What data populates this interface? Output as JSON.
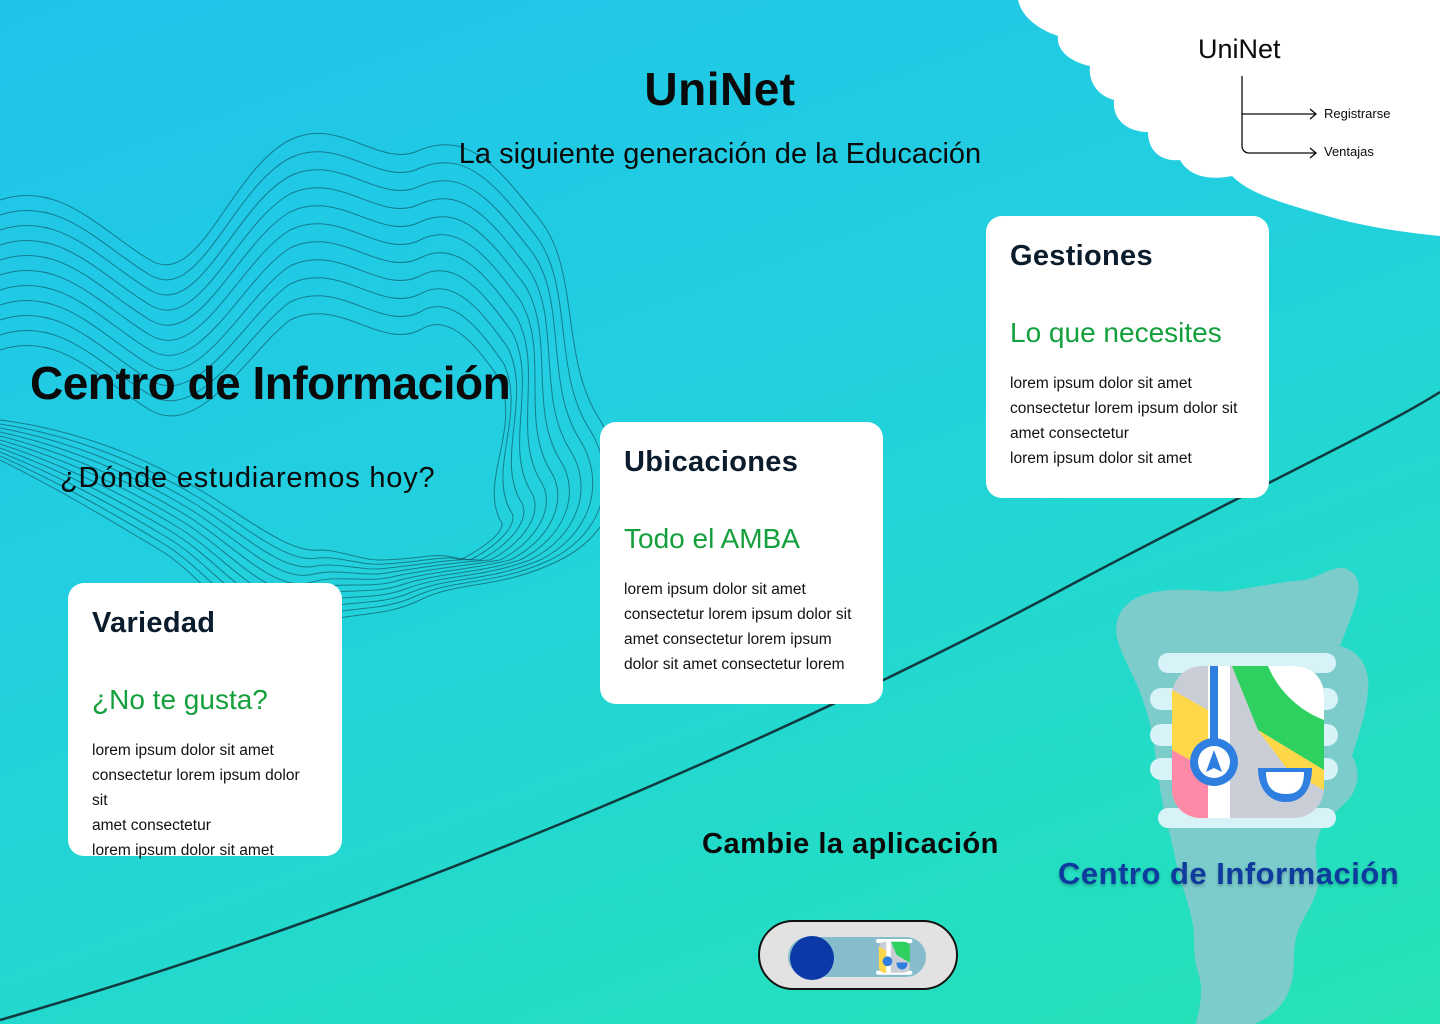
{
  "brand": {
    "title": "UniNet",
    "subtitle": "La siguiente generación de la Educación"
  },
  "hero": {
    "title": "Centro de Información",
    "question": "¿Dónde estudiaremos hoy?"
  },
  "nav": {
    "title": "UniNet",
    "items": [
      {
        "label": "Registrarse"
      },
      {
        "label": "Ventajas"
      }
    ]
  },
  "cards": [
    {
      "title": "Variedad",
      "subtitle": "¿No te gusta?",
      "body": "lorem ipsum dolor sit amet\nconsectetur lorem ipsum dolor sit\namet consectetur\nlorem ipsum dolor sit amet"
    },
    {
      "title": "Ubicaciones",
      "subtitle": "Todo el AMBA",
      "body": "lorem ipsum dolor sit amet\nconsectetur lorem ipsum dolor sit\namet consectetur lorem ipsum\ndolor sit amet consectetur lorem"
    },
    {
      "title": "Gestiones",
      "subtitle": "Lo que necesites",
      "body": "lorem ipsum dolor sit amet\nconsectetur lorem ipsum dolor sit\namet consectetur\nlorem ipsum dolor sit amet"
    }
  ],
  "cta": {
    "label": "Cambie la aplicación"
  },
  "app": {
    "label": "Centro de Información",
    "icon": "maps-app-icon"
  },
  "colors": {
    "accent_green": "#14a03c",
    "brand_blue": "#0d3b9e",
    "knob_blue": "#0b3aa8",
    "background_start": "#1fc3ea",
    "background_end": "#26e3b4"
  }
}
